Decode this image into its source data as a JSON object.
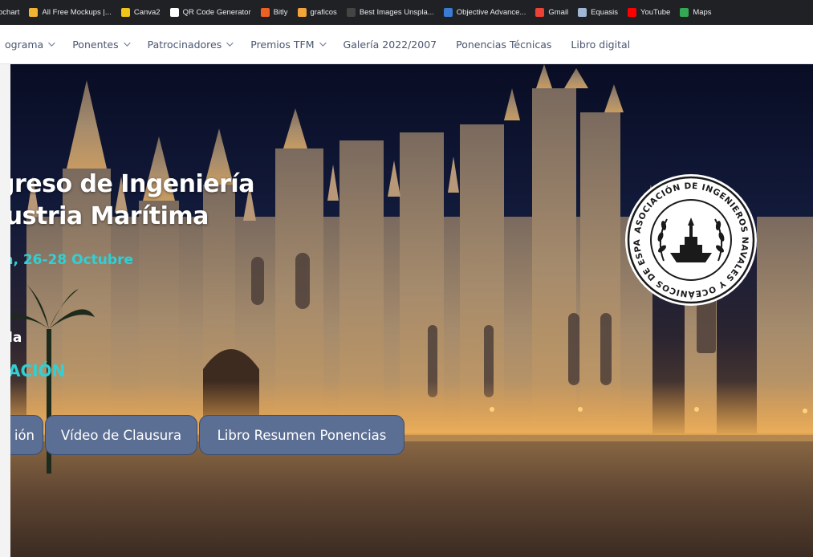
{
  "bookmarks": [
    {
      "label": "ochart",
      "color": "#3b7be0"
    },
    {
      "label": "All Free Mockups |...",
      "color": "#f2b233"
    },
    {
      "label": "Canva2",
      "color": "#f0c419"
    },
    {
      "label": "QR Code Generator",
      "color": "#ffffff"
    },
    {
      "label": "Bitly",
      "color": "#ee6123"
    },
    {
      "label": "graficos",
      "color": "#f2a33a"
    },
    {
      "label": "Best Images Unspla...",
      "color": "#444444"
    },
    {
      "label": "Objective Advance...",
      "color": "#3a7bd5"
    },
    {
      "label": "Gmail",
      "color": "#ea4335"
    },
    {
      "label": "Equasis",
      "color": "#9fb6d6"
    },
    {
      "label": "YouTube",
      "color": "#ff0000"
    },
    {
      "label": "Maps",
      "color": "#34a853"
    }
  ],
  "nav": {
    "items": [
      {
        "label": "ograma",
        "has_dropdown": true
      },
      {
        "label": "Ponentes",
        "has_dropdown": true
      },
      {
        "label": "Patrocinadores",
        "has_dropdown": true
      },
      {
        "label": "Premios TFM",
        "has_dropdown": true
      },
      {
        "label": "Galería 2022/2007",
        "has_dropdown": false
      },
      {
        "label": "Ponencias Técnicas",
        "has_dropdown": false
      },
      {
        "label": "Libro digital",
        "has_dropdown": false
      }
    ]
  },
  "hero": {
    "title_line1": "greso de Ingeniería",
    "title_line2": "lustria Marítima",
    "date": "a, 26-28 Octubre",
    "subtitle_line1": "la",
    "subtitle_line2": "ACIÓN",
    "buttons": [
      {
        "label": "ión"
      },
      {
        "label": "Vídeo de Clausura"
      },
      {
        "label": "Libro Resumen Ponencias"
      }
    ],
    "seal": {
      "text_top": "ASOCIACIÓN DE INGENIEROS NAVALES Y OCEÁNICOS DE ESPAÑA"
    }
  },
  "colors": {
    "accent_teal": "#2fd0d6",
    "button_bg": "#5b6e93",
    "nav_text": "#4a5570"
  }
}
